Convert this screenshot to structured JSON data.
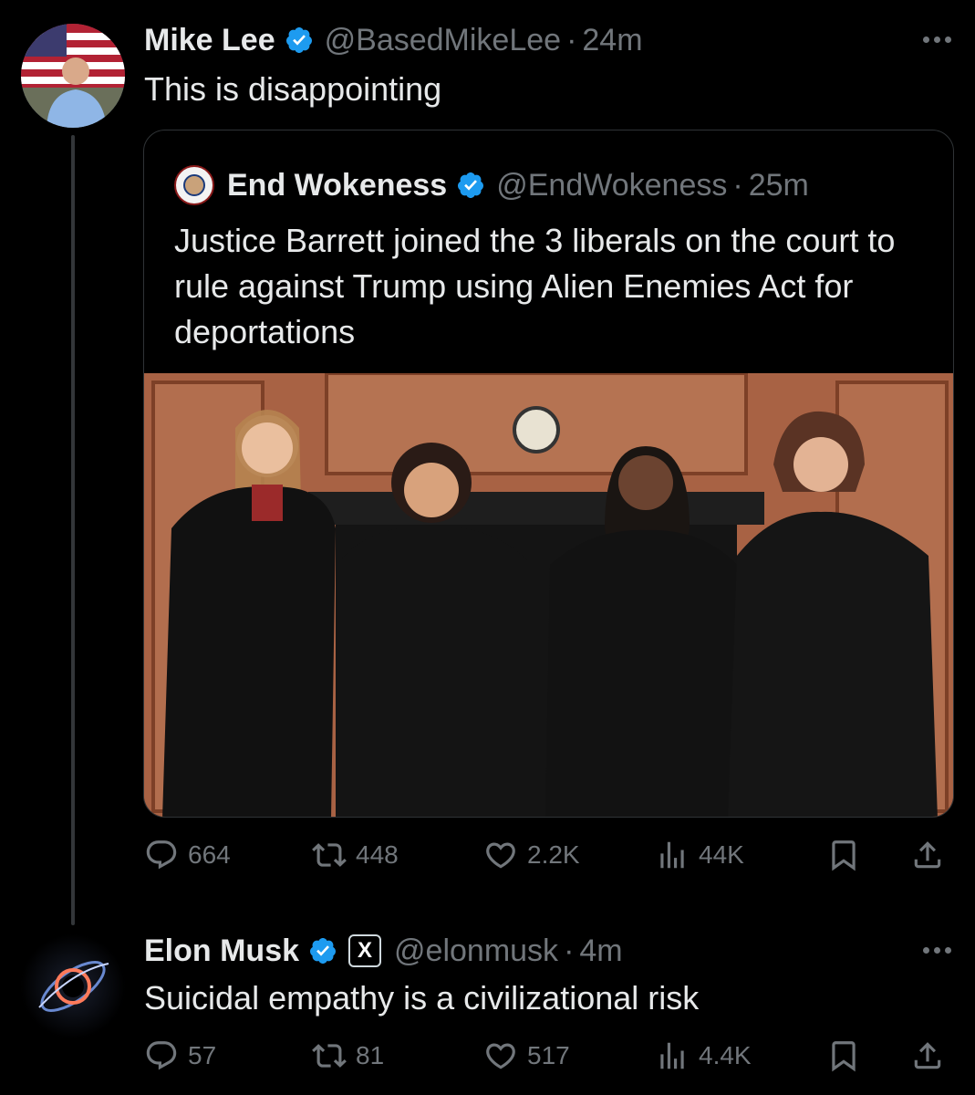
{
  "colors": {
    "background": "#000000",
    "text_primary": "#e7e9ea",
    "text_secondary": "#71767b",
    "verified_blue": "#1d9bf0",
    "border": "#2f3336"
  },
  "post": {
    "author_name": "Mike Lee",
    "handle": "@BasedMikeLee",
    "separator": "·",
    "time": "24m",
    "text": "This is disappointing",
    "quote": {
      "author_name": "End Wokeness",
      "handle": "@EndWokeness",
      "separator": "·",
      "time": "25m",
      "text": "Justice Barrett joined the 3 liberals on the court to rule against Trump using Alien Enemies Act for deportations",
      "image": "photo of four justices in black robes standing in a wood-paneled room"
    },
    "stats": {
      "replies": "664",
      "reposts": "448",
      "likes": "2.2K",
      "views": "44K"
    }
  },
  "reply": {
    "author_name": "Elon Musk",
    "handle": "@elonmusk",
    "badge": "X",
    "separator": "·",
    "time": "4m",
    "text": "Suicidal empathy is a civilizational risk",
    "stats": {
      "replies": "57",
      "reposts": "81",
      "likes": "517",
      "views": "4.4K"
    }
  },
  "icons": [
    "verified-badge-icon",
    "more-options-icon",
    "reply-icon",
    "repost-icon",
    "like-icon",
    "views-icon",
    "bookmark-icon",
    "share-icon"
  ]
}
